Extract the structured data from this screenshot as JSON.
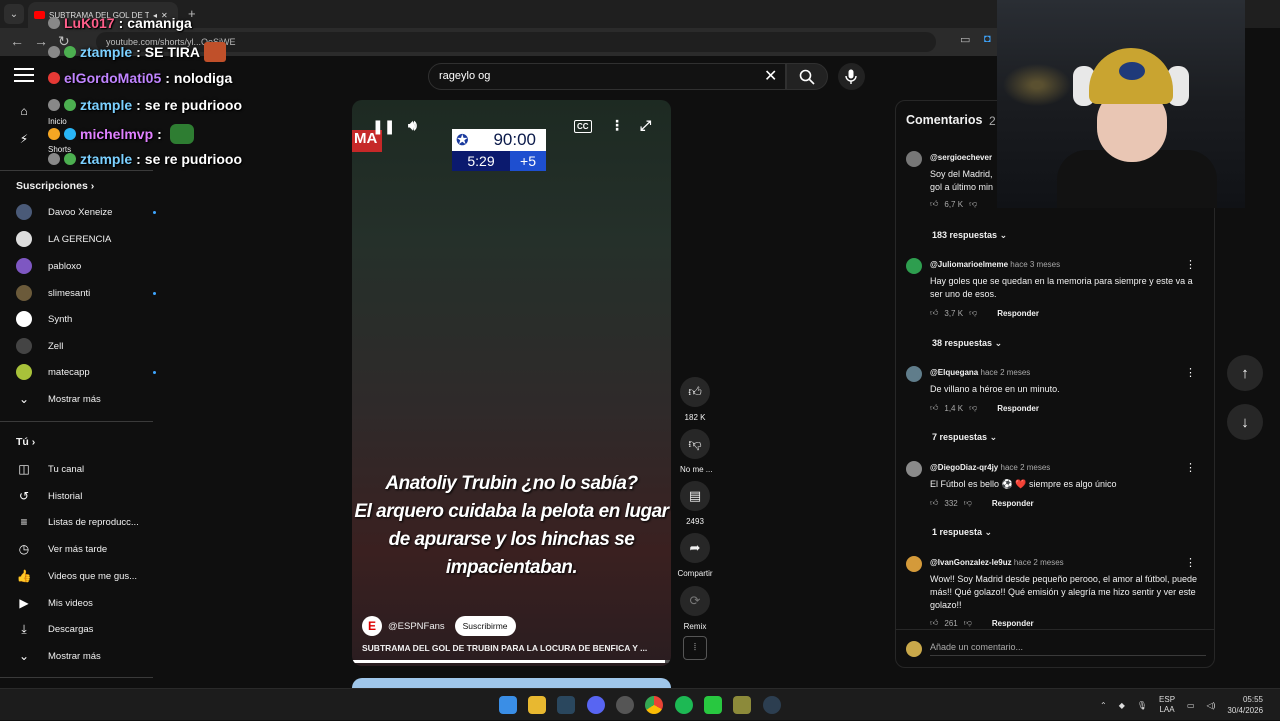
{
  "browser": {
    "tab_title": "SUBTRAMA DEL GOL DE TR",
    "url": "youtube.com/shorts/yl...OeSjWE",
    "newtab": "+"
  },
  "chat": [
    {
      "user": "LuK017",
      "msg": "camaniga",
      "color": "#ff5e8a"
    },
    {
      "user": "ztample",
      "msg": "SE TIRA",
      "color": "#7bd0ff"
    },
    {
      "user": "elGordoMati05",
      "msg": "nolodiga",
      "color": "#c084ff"
    },
    {
      "user": "ztample",
      "msg": "se re pudriooo",
      "color": "#7bd0ff"
    },
    {
      "user": "michelmvp",
      "msg": "",
      "color": "#e080ff"
    },
    {
      "user": "ztample",
      "msg": "se re pudriooo",
      "color": "#7bd0ff"
    }
  ],
  "search": {
    "value": "rageylo og"
  },
  "sidebar": {
    "top": [
      {
        "label": "Inicio",
        "icon": "home-icon"
      },
      {
        "label": "Shorts",
        "icon": "shorts-icon"
      }
    ],
    "subs_title": "Suscripciones",
    "subs": [
      {
        "label": "Davoo Xeneize",
        "color": "#4a5a78",
        "live": true
      },
      {
        "label": "LA GERENCIA",
        "color": "#dddddd",
        "live": false
      },
      {
        "label": "pabloxo",
        "color": "#7e57c2",
        "live": false
      },
      {
        "label": "slimesanti",
        "color": "#6b5a3a",
        "live": true
      },
      {
        "label": "Synth",
        "color": "#ffffff",
        "live": false
      },
      {
        "label": "Zell",
        "color": "#444444",
        "live": false
      },
      {
        "label": "matecapp",
        "color": "#a8c23a",
        "live": true
      }
    ],
    "subs_more": "Mostrar más",
    "you_title": "Tú",
    "you": [
      {
        "label": "Tu canal",
        "icon": "channel-icon"
      },
      {
        "label": "Historial",
        "icon": "history-icon"
      },
      {
        "label": "Listas de reproducc...",
        "icon": "playlist-icon"
      },
      {
        "label": "Ver más tarde",
        "icon": "clock-icon"
      },
      {
        "label": "Videos que me gus...",
        "icon": "like-icon"
      },
      {
        "label": "Mis videos",
        "icon": "video-icon"
      },
      {
        "label": "Descargas",
        "icon": "download-icon"
      },
      {
        "label": "Mostrar más",
        "icon": "chevron-down-icon"
      }
    ]
  },
  "video": {
    "score_time": "90:00",
    "score_clock": "5:29",
    "score_added": "+5",
    "brand_fragment": "MA",
    "subtitle_lines": [
      "Anatoliy Trubin ¿no lo sabía?",
      "El arquero cuidaba la pelota en lugar",
      "de apurarse y los hinchas se impacientaban."
    ],
    "channel": "@ESPNFans",
    "subscribe": "Suscribirme",
    "title": "SUBTRAMA DEL GOL DE TRUBIN PARA LA LOCURA DE BENFICA Y ...",
    "progress": 0.98
  },
  "actions": {
    "likes": "182 K",
    "dislike": "No me ...",
    "comments": "2493",
    "share": "Compartir",
    "remix": "Remix"
  },
  "comments": {
    "title": "Comentarios",
    "count": "2",
    "items": [
      {
        "user": "@sergioechever",
        "when": "",
        "text": "Soy del Madrid, gol a último min",
        "likes": "6,7 K",
        "replies": "183 respuestas",
        "avatar": "#777777"
      },
      {
        "user": "@Juliomarioelmeme",
        "when": "hace 3 meses",
        "text": "Hay goles que se quedan en la memoria para siempre y este va a ser uno de esos.",
        "likes": "3,7 K",
        "replies": "38 respuestas",
        "avatar": "#2e9e4f"
      },
      {
        "user": "@Elquegana",
        "when": "hace 2 meses",
        "text": "De villano a héroe en un minuto.",
        "likes": "1,4 K",
        "replies": "7 respuestas",
        "avatar": "#607d8b"
      },
      {
        "user": "@DiegoDiaz-qr4jy",
        "when": "hace 2 meses",
        "text": "El Fútbol es bello ⚽ ❤️ siempre es algo único",
        "likes": "332",
        "replies": "1 respuesta",
        "avatar": "#8a8a8a"
      },
      {
        "user": "@IvanGonzalez-le9uz",
        "when": "hace 2 meses",
        "text": "Wow!! Soy Madrid desde pequeño perooo, el amor al fútbol, puede más!! Qué golazo!! Qué emisión y alegría me hizo sentir y ver este golazo!!",
        "likes": "261",
        "replies": "",
        "avatar": "#d49a3a"
      }
    ],
    "reply_label": "Responder",
    "add_placeholder": "Añade un comentario..."
  },
  "taskbar": {
    "lang1": "ESP",
    "lang2": "LAA",
    "time": "05:55",
    "date": "30/4/2026"
  }
}
